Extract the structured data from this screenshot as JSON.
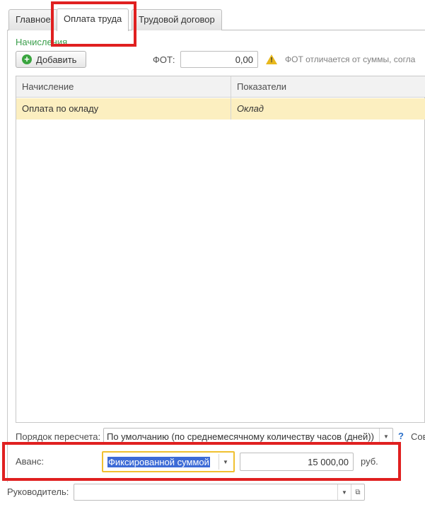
{
  "tabs": [
    {
      "label": "Главное"
    },
    {
      "label": "Оплата труда"
    },
    {
      "label": "Трудовой договор"
    }
  ],
  "accruals": {
    "group_title": "Начисления",
    "add_button": "Добавить",
    "fot_label": "ФОТ:",
    "fot_value": "0,00",
    "fot_warning": "ФОТ отличается от суммы, согла",
    "columns": [
      "Начисление",
      "Показатели"
    ],
    "rows": [
      {
        "name": "Оплата по окладу",
        "indicator": "Оклад"
      }
    ]
  },
  "recalc": {
    "label": "Порядок пересчета:",
    "value": "По умолчанию (по среднемесячному количеству часов (дней))",
    "help": "?",
    "trailing": "Сов"
  },
  "advance": {
    "label": "Аванс:",
    "method": "Фиксированной суммой",
    "amount": "15 000,00",
    "currency": "руб."
  },
  "manager": {
    "label": "Руководитель:",
    "value": ""
  },
  "colors": {
    "accent_green": "#3a9e4b",
    "selected_row": "#fcefc0",
    "highlight_box": "#e02020",
    "focus_border": "#f0c030",
    "selection": "#3d6bd6"
  }
}
